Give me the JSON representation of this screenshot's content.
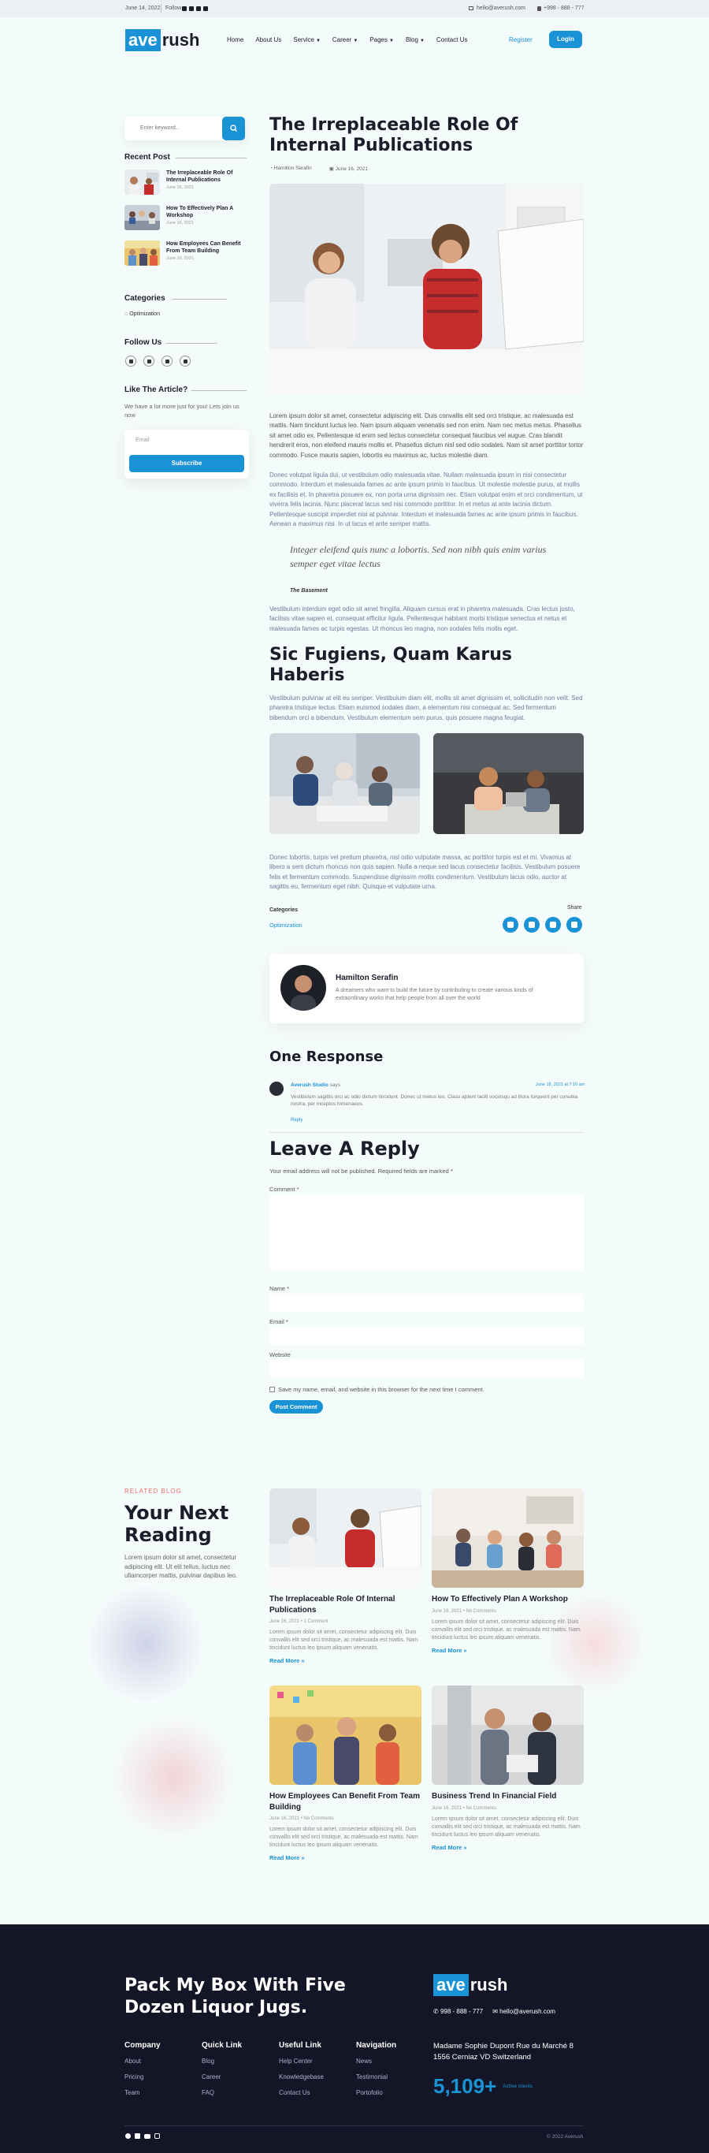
{
  "topbar": {
    "date": "June 14, 2022",
    "follow": "Follow",
    "email": "hello@averush.com",
    "phone": "+998 - 888 - 777"
  },
  "brand": {
    "logo_box": "ave",
    "logo_rest": "rush"
  },
  "nav": {
    "items": [
      "Home",
      "About Us",
      "Service",
      "Career",
      "Pages",
      "Blog",
      "Contact Us"
    ],
    "register": "Register",
    "login": "Login"
  },
  "sidebar": {
    "search_placeholder": "Enter keyword...",
    "recent_title": "Recent Post",
    "recent": [
      {
        "title": "The Irreplaceable Role Of Internal Publications",
        "date": "June 16, 2021"
      },
      {
        "title": "How To Effectively Plan A Workshop",
        "date": "June 16, 2021"
      },
      {
        "title": "How Employees Can Benefit From Team Building",
        "date": "June 16, 2021"
      }
    ],
    "categories_title": "Categories",
    "category": "Optimization",
    "follow_title": "Follow Us",
    "like_title": "Like The Article?",
    "like_text": "We have a lot more just for you! Lets join us now",
    "email_placeholder": "Email",
    "subscribe": "Subscribe"
  },
  "article": {
    "title": "The Irreplaceable Role Of Internal Publications",
    "author": "Hamilton Serafin",
    "date": "June 16, 2021",
    "p1": "Lorem ipsum dolor sit amet, consectetur adipiscing elit. Duis convallis elit sed orci tristique, ac malesuada est mattis. Nam tincidunt luctus leo. Nam ipsum aliquam venenatis sed non enim. Nam nec metus metus. Phasellus sit amet odio ex. Pellentesque id enim sed lectus consectetur consequat faucibus vel augue. Cras blandit hendrerit eros, non eleifend mauris mollis et. Phasellus dictum nisl sed odio sodales. Nam sit amet porttitor tortor commodo. Fusce mauris sapien, lobortis eu maximus ac, luctus molestie diam.",
    "p2": "Donec volutpat ligula dui, ut vestibulum odio malesuada vitae. Nullam malesuada ipsum in nisi consectetur commodo. Interdum et malesuada fames ac ante ipsum primis in faucibus. Ut molestie molestie purus, at mollis ex facilisis et. In pharetra posuere ex, non porta urna dignissim nec. Etiam volutpat enim et orci condimentum, ut viverra felis lacinia. Nunc placerat lacus sed nisi commodo porttitor. In et metus at ante lacinia dictum. Pellentesque suscipit imperdiet nisi at pulvinar. Interdum et malesuada fames ac ante ipsum primis in faucibus. Aenean a maximus nisi. In ut lacus et ante semper mattis.",
    "quote": "Integer eleifend quis nunc a lobortis. Sed non nibh quis enim varius semper eget vitae lectus",
    "quote_cite": "The Basement",
    "p3": "Vestibulum interdum eget odio sit amet fringilla. Aliquam cursus erat in pharetra malesuada. Cras lectus justo, facilisis vitae sapien et, consequat efficitur ligula. Pellentesque habitant morbi tristique senectus et netus et malesuada fames ac turpis egestas. Ut rhoncus leo magna, non sodales felis mollis eget.",
    "h2": "Sic Fugiens, Quam Karus Haberis",
    "p4": "Vestibulum pulvinar at elit eu semper. Vestibulum diam elit, mollis sit amet dignissim et, sollicitudin non velit. Sed pharetra tristique lectus. Etiam euismod sodales diam, a elementum nisi consequat ac. Sed fermentum bibendum orci a bibendum. Vestibulum elementum sem purus, quis posuere magna feugiat.",
    "p5": "Donec lobortis, turpis vel pretium pharetra, nisl odio vulputate massa, ac porttitor turpis est et mi. Vivamus at libero a sem dictum rhoncus non quis sapien. Nulla a neque sed lacus consectetur facilisis. Vestibulum posuere felis et fermentum commodo. Suspendisse dignissim mollis condimentum. Vestibulum lacus odio, auctor at sagittis eu, fermentum eget nibh. Quisque et vulputate urna.",
    "categories_label": "Categories",
    "category": "Optimization",
    "share_label": "Share"
  },
  "author_box": {
    "name": "Hamilton Serafin",
    "bio": "A dreamers who want to build the future by contributing to create various kinds of extraordinary works that help people from all over the world"
  },
  "comments": {
    "title": "One Response",
    "name": "Averush Studio",
    "says": "says",
    "date": "June 18, 2021 at 7:10 am",
    "text": "Vestibulum sagittis orci ac odio dictum tincidunt. Donec ut metus leo. Class aptent taciti sociosqu ad litora torquent per conubia nostra, per inceptos himenaeos.",
    "reply": "Reply"
  },
  "reply_form": {
    "title": "Leave A Reply",
    "note": "Your email address will not be published. Required fields are marked *",
    "comment": "Comment *",
    "name": "Name *",
    "email": "Email *",
    "website": "Website",
    "save": "Save my name, email, and website in this browser for the next time I comment.",
    "submit": "Post Comment"
  },
  "related": {
    "eyebrow": "RELATED BLOG",
    "title": "Your Next Reading",
    "intro": "Lorem ipsum dolor sit amet, consectetur adipiscing elit. Ut elit tellus, luctus nec ullamcorper mattis, pulvinar dapibus leo.",
    "cards": [
      {
        "title": "The Irreplaceable Role Of Internal Publications",
        "meta": "June 16, 2021 • 1 Comment",
        "text": "Lorem ipsum dolor sit amet, consectetur adipiscing elit. Duis convallis elit sed orci tristique, ac malesuada est mattis. Nam tincidunt luctus leo ipsum aliquam venenatis.",
        "more": "Read More »"
      },
      {
        "title": "How To Effectively Plan A Workshop",
        "meta": "June 16, 2021 • No Comments",
        "text": "Lorem ipsum dolor sit amet, consectetur adipiscing elit. Duis convallis elit sed orci tristique, ac malesuada est mattis. Nam tincidunt luctus leo ipsum aliquam venenatis.",
        "more": "Read More »"
      },
      {
        "title": "How Employees Can Benefit From Team Building",
        "meta": "June 16, 2021 • No Comments",
        "text": "Lorem ipsum dolor sit amet, consectetur adipiscing elit. Duis convallis elit sed orci tristique, ac malesuada est mattis. Nam tincidunt luctus leo ipsum aliquam venenatis.",
        "more": "Read More »"
      },
      {
        "title": "Business Trend In Financial Field",
        "meta": "June 16, 2021 • No Comments",
        "text": "Lorem ipsum dolor sit amet, consectetur adipiscing elit. Duis convallis elit sed orci tristique, ac malesuada est mattis. Nam tincidunt luctus leo ipsum aliquam venenatis.",
        "more": "Read More »"
      }
    ]
  },
  "footer": {
    "headline": "Pack My Box With Five Dozen Liquor Jugs.",
    "logo_box": "ave",
    "logo_rest": "rush",
    "phone": "998 - 888 - 777",
    "email": "hello@averush.com",
    "address": "Madame Sophie Dupont Rue du Marché 8 1556 Cerniaz VD Switzerland",
    "stat": "5,109+",
    "stat_label": "Active clients",
    "cols": [
      {
        "title": "Company",
        "links": [
          "About",
          "Pricing",
          "Team"
        ]
      },
      {
        "title": "Quick Link",
        "links": [
          "Blog",
          "Career",
          "FAQ"
        ]
      },
      {
        "title": "Useful Link",
        "links": [
          "Help Center",
          "Knowledgebase",
          "Contact Us"
        ]
      },
      {
        "title": "Navigation",
        "links": [
          "News",
          "Testimonial",
          "Portofolio"
        ]
      }
    ],
    "copyright": "© 2022 Averush"
  }
}
